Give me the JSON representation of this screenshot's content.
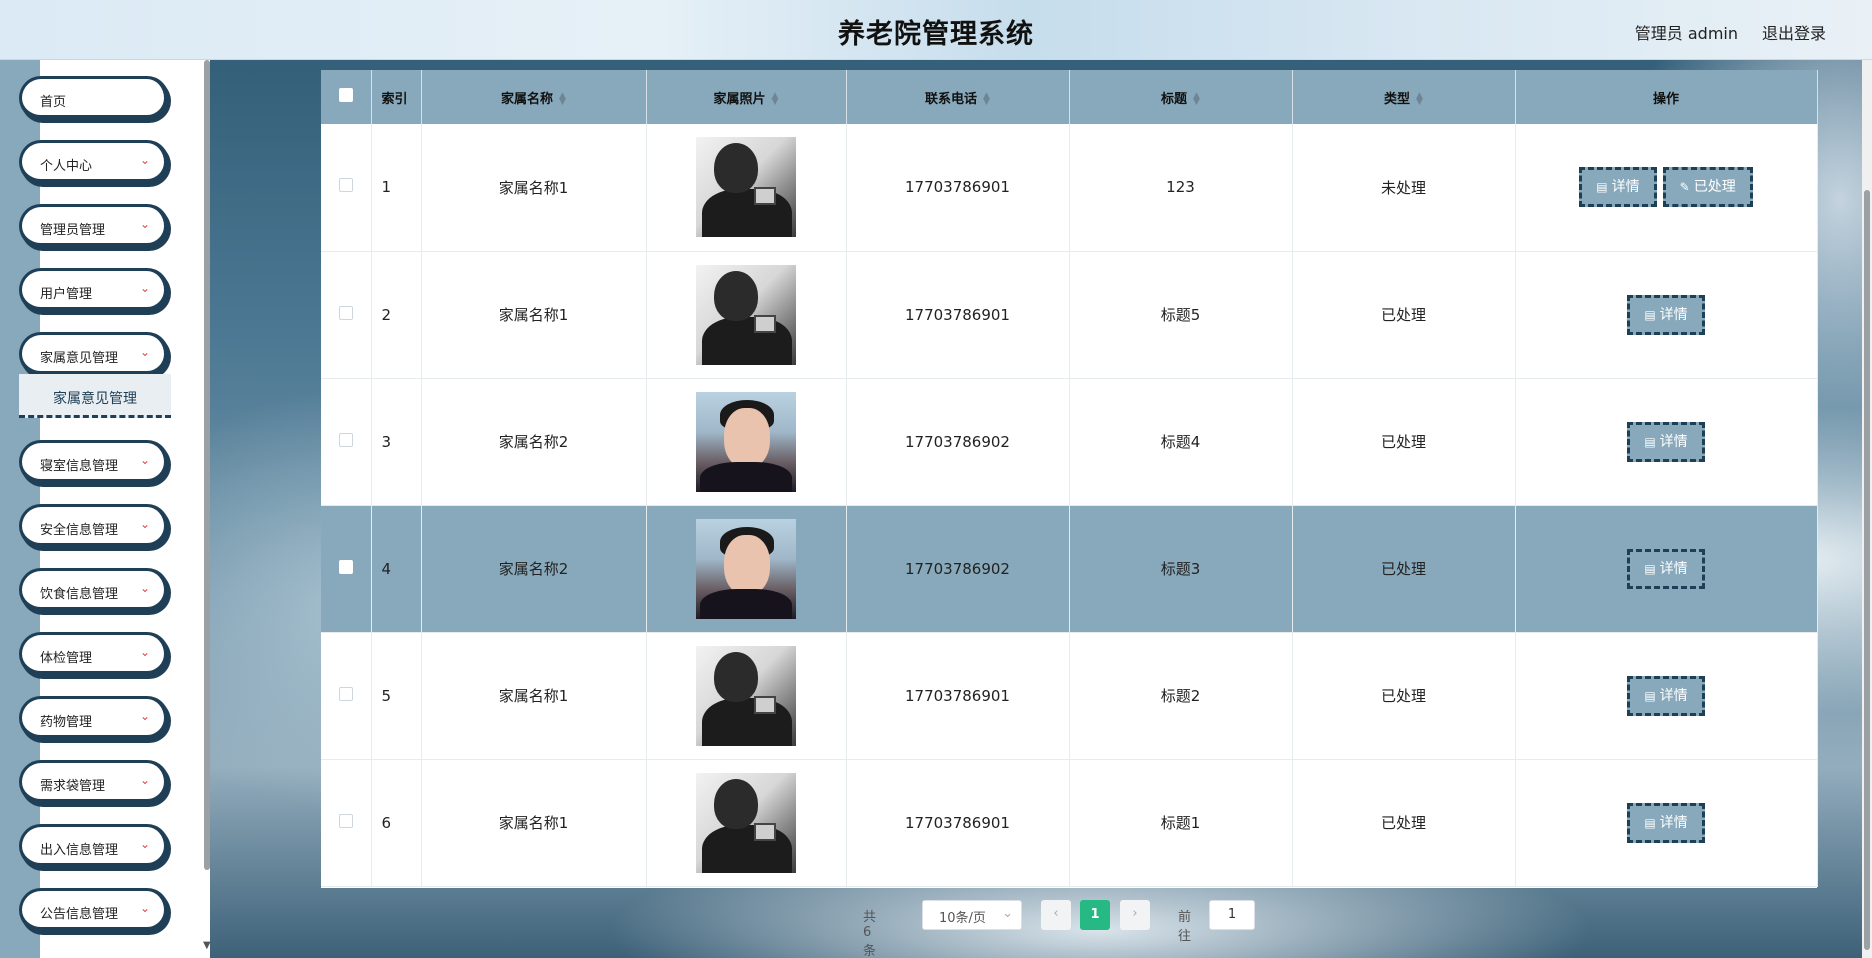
{
  "header": {
    "title": "养老院管理系统",
    "user_label": "管理员 admin",
    "logout_label": "退出登录"
  },
  "sidebar": {
    "items": [
      {
        "label": "首页",
        "has_chevron": false
      },
      {
        "label": "个人中心",
        "has_chevron": true
      },
      {
        "label": "管理员管理",
        "has_chevron": true
      },
      {
        "label": "用户管理",
        "has_chevron": true
      },
      {
        "label": "家属意见管理",
        "has_chevron": true
      },
      {
        "label": "寝室信息管理",
        "has_chevron": true
      },
      {
        "label": "安全信息管理",
        "has_chevron": true
      },
      {
        "label": "饮食信息管理",
        "has_chevron": true
      },
      {
        "label": "体检管理",
        "has_chevron": true
      },
      {
        "label": "药物管理",
        "has_chevron": true
      },
      {
        "label": "需求袋管理",
        "has_chevron": true
      },
      {
        "label": "出入信息管理",
        "has_chevron": true
      },
      {
        "label": "公告信息管理",
        "has_chevron": true
      }
    ],
    "active_sub": "家属意见管理"
  },
  "table": {
    "columns": [
      "索引",
      "家属名称",
      "家属照片",
      "联系电话",
      "标题",
      "类型",
      "操作"
    ],
    "rows": [
      {
        "index": "1",
        "name": "家属名称1",
        "photo": "bw",
        "phone": "17703786901",
        "title": "123",
        "type": "未处理",
        "actions": [
          "详情",
          "已处理"
        ]
      },
      {
        "index": "2",
        "name": "家属名称1",
        "photo": "bw",
        "phone": "17703786901",
        "title": "标题5",
        "type": "已处理",
        "actions": [
          "详情"
        ]
      },
      {
        "index": "3",
        "name": "家属名称2",
        "photo": "color",
        "phone": "17703786902",
        "title": "标题4",
        "type": "已处理",
        "actions": [
          "详情"
        ]
      },
      {
        "index": "4",
        "name": "家属名称2",
        "photo": "color",
        "phone": "17703786902",
        "title": "标题3",
        "type": "已处理",
        "actions": [
          "详情"
        ],
        "highlighted": true
      },
      {
        "index": "5",
        "name": "家属名称1",
        "photo": "bw",
        "phone": "17703786901",
        "title": "标题2",
        "type": "已处理",
        "actions": [
          "详情"
        ]
      },
      {
        "index": "6",
        "name": "家属名称1",
        "photo": "bw",
        "phone": "17703786901",
        "title": "标题1",
        "type": "已处理",
        "actions": [
          "详情"
        ]
      }
    ]
  },
  "pager": {
    "total": "共 6 条",
    "page_size": "10条/页",
    "current": "1",
    "jump_label": "前往",
    "jump_value": "1"
  },
  "colors": {
    "accent": "#88a9bb",
    "border_dark": "#1f3f57",
    "pager_active": "#26b983",
    "chevron": "#e0453b"
  }
}
